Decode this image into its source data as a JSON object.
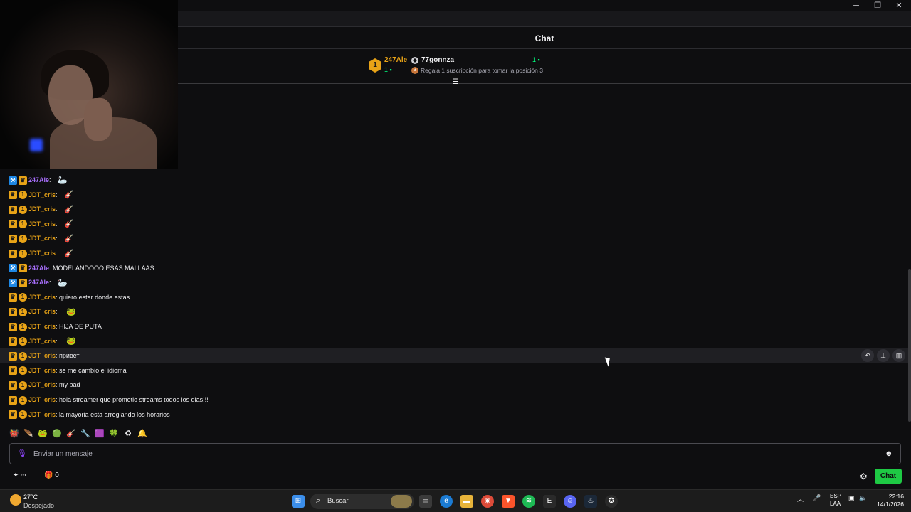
{
  "chat": {
    "header_title": "Chat"
  },
  "leaderboard": {
    "rank_number": "1",
    "first_name": "247Ale",
    "first_count": "1",
    "second_name": "77gonnza",
    "second_count": "1",
    "gift_text": "Regala 1 suscripción para tomar la posición 3"
  },
  "messages": [
    {
      "user": "247Ale",
      "color": "purple",
      "mod": true,
      "gift": false,
      "text": "",
      "emote": "goose"
    },
    {
      "user": "JDT_cris",
      "color": "gold",
      "mod": false,
      "gift": true,
      "text": "",
      "emote": "guitar"
    },
    {
      "user": "JDT_cris",
      "color": "gold",
      "mod": false,
      "gift": true,
      "text": "",
      "emote": "guitar"
    },
    {
      "user": "JDT_cris",
      "color": "gold",
      "mod": false,
      "gift": true,
      "text": "",
      "emote": "guitar"
    },
    {
      "user": "JDT_cris",
      "color": "gold",
      "mod": false,
      "gift": true,
      "text": "",
      "emote": "guitar"
    },
    {
      "user": "JDT_cris",
      "color": "gold",
      "mod": false,
      "gift": true,
      "text": "",
      "emote": "guitar"
    },
    {
      "user": "247Ale",
      "color": "purple",
      "mod": true,
      "gift": false,
      "text": "MODELANDOOO ESAS MALLAAS",
      "emote": ""
    },
    {
      "user": "247Ale",
      "color": "purple",
      "mod": true,
      "gift": false,
      "text": "",
      "emote": "goose"
    },
    {
      "user": "JDT_cris",
      "color": "gold",
      "mod": false,
      "gift": true,
      "text": "quiero estar donde estas",
      "emote": ""
    },
    {
      "user": "JDT_cris",
      "color": "gold",
      "mod": false,
      "gift": true,
      "text": "",
      "emote": "frog"
    },
    {
      "user": "JDT_cris",
      "color": "gold",
      "mod": false,
      "gift": true,
      "text": "HIJA DE PUTA",
      "emote": ""
    },
    {
      "user": "JDT_cris",
      "color": "gold",
      "mod": false,
      "gift": true,
      "text": "",
      "emote": "frog"
    },
    {
      "user": "JDT_cris",
      "color": "gold",
      "mod": false,
      "gift": true,
      "text": "привет",
      "emote": "",
      "highlight": true
    },
    {
      "user": "JDT_cris",
      "color": "gold",
      "mod": false,
      "gift": true,
      "text": "se me cambio el idioma",
      "emote": ""
    },
    {
      "user": "JDT_cris",
      "color": "gold",
      "mod": false,
      "gift": true,
      "text": "my bad",
      "emote": ""
    },
    {
      "user": "JDT_cris",
      "color": "gold",
      "mod": false,
      "gift": true,
      "text": "hola streamer que prometio streams todos los dias!!!",
      "emote": ""
    },
    {
      "user": "JDT_cris",
      "color": "gold",
      "mod": false,
      "gift": true,
      "text": "la mayoria esta arreglando los horarios",
      "emote": ""
    }
  ],
  "badges": {
    "mod_glyph": "⚒",
    "crown_glyph": "♛",
    "gift_glyph": "1"
  },
  "emote_glyphs": {
    "goose": "🦢",
    "guitar": "🎸",
    "frog": "🐸"
  },
  "emote_bar": [
    "👹",
    "🪶",
    "🐸",
    "🟢",
    "🎸",
    "🔧",
    "🟪",
    "🍀",
    "♻",
    "🔔"
  ],
  "input": {
    "placeholder": "Enviar un mensaje"
  },
  "bottom": {
    "points_value": "∞",
    "gift_count": "0",
    "chat_button_label": "Chat"
  },
  "taskbar": {
    "weather_temp": "27°C",
    "weather_desc": "Despejado",
    "search_label": "Buscar",
    "lang_top": "ESP",
    "lang_bottom": "LAA",
    "time": "22:16",
    "date": "14/1/2026"
  },
  "colors": {
    "accent_green": "#1ec944",
    "gold": "#e8a317",
    "purple": "#a970ff"
  }
}
